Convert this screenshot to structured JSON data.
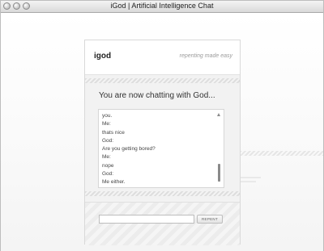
{
  "window": {
    "title": "iGod | Artificial Intelligence Chat"
  },
  "app": {
    "logo": "igod",
    "tagline": "repenting made easy"
  },
  "chat": {
    "header": "You are now chatting with God...",
    "lines": [
      "you.",
      "Me:",
      " thats nice",
      "God:",
      "Are you getting bored?",
      "Me:",
      " nope",
      "God:",
      "Me either."
    ]
  },
  "form": {
    "input_value": "",
    "button_label": "REPENT"
  }
}
